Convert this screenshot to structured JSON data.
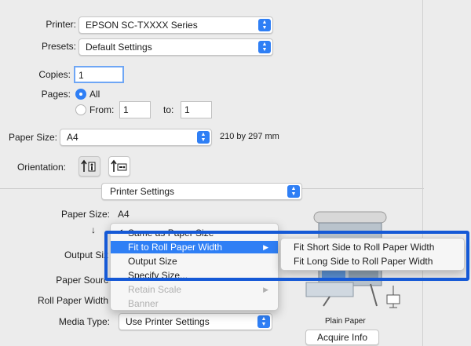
{
  "printer": {
    "label": "Printer:",
    "value": "EPSON SC-TXXXX Series"
  },
  "presets": {
    "label": "Presets:",
    "value": "Default Settings"
  },
  "copies": {
    "label": "Copies:",
    "value": "1"
  },
  "pages": {
    "label": "Pages:",
    "all": "All",
    "from_label": "From:",
    "from_value": "1",
    "to_label": "to:",
    "to_value": "1"
  },
  "paper_size": {
    "label": "Paper Size:",
    "value": "A4",
    "dims": "210 by 297 mm"
  },
  "orientation": {
    "label": "Orientation:"
  },
  "section": {
    "value": "Printer Settings"
  },
  "settings": {
    "paper_size_label": "Paper Size:",
    "paper_size_value": "A4",
    "output_size_label": "Output Siz",
    "paper_source_label": "Paper Sourc",
    "roll_paper_width_label": "Roll Paper Width",
    "media_type_label": "Media Type:",
    "media_type_value": "Use Printer Settings"
  },
  "menu": {
    "items": [
      "Same as Paper Size",
      "Fit to Roll Paper Width",
      "Output Size",
      "Specify Size...",
      "Retain Scale",
      "Banner"
    ]
  },
  "submenu": {
    "items": [
      "Fit Short Side to Roll Paper Width",
      "Fit Long Side to Roll Paper Width"
    ]
  },
  "preview": {
    "caption": "Plain Paper"
  },
  "acquire_info": {
    "label": "Acquire Info"
  },
  "colors": {
    "accent": "#2f7ff5",
    "highlight_border": "#1559d6",
    "background": "#ececec"
  }
}
